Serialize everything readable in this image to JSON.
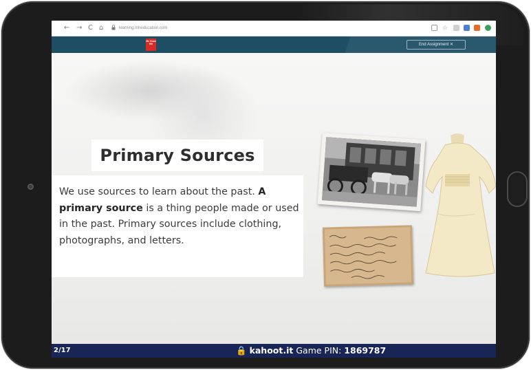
{
  "browser": {
    "url": "learning.mheducation.com",
    "nav": {
      "back": "←",
      "forward": "→",
      "reload": "C",
      "home": "⌂"
    }
  },
  "header": {
    "logo": "Mc Graw Hill",
    "end_button": "End Assignment ✕"
  },
  "slide": {
    "title": "Primary Sources",
    "body_intro": "We use sources to learn about the past. ",
    "body_bold": "A primary source",
    "body_rest": " is a thing people made or used in the past. Primary sources include clothing, photographs, and letters."
  },
  "kahoot": {
    "page": "2/17",
    "lock": "🔒",
    "site": "kahoot.it",
    "pin_label": " Game PIN: ",
    "pin": "1869787"
  },
  "colors": {
    "header_bg": "#1d4e64",
    "kahoot_bar": "#1a2557",
    "logo_red": "#d62b26"
  },
  "icons": [
    "camera-icon",
    "home-button",
    "lock-icon",
    "extension-icon"
  ]
}
